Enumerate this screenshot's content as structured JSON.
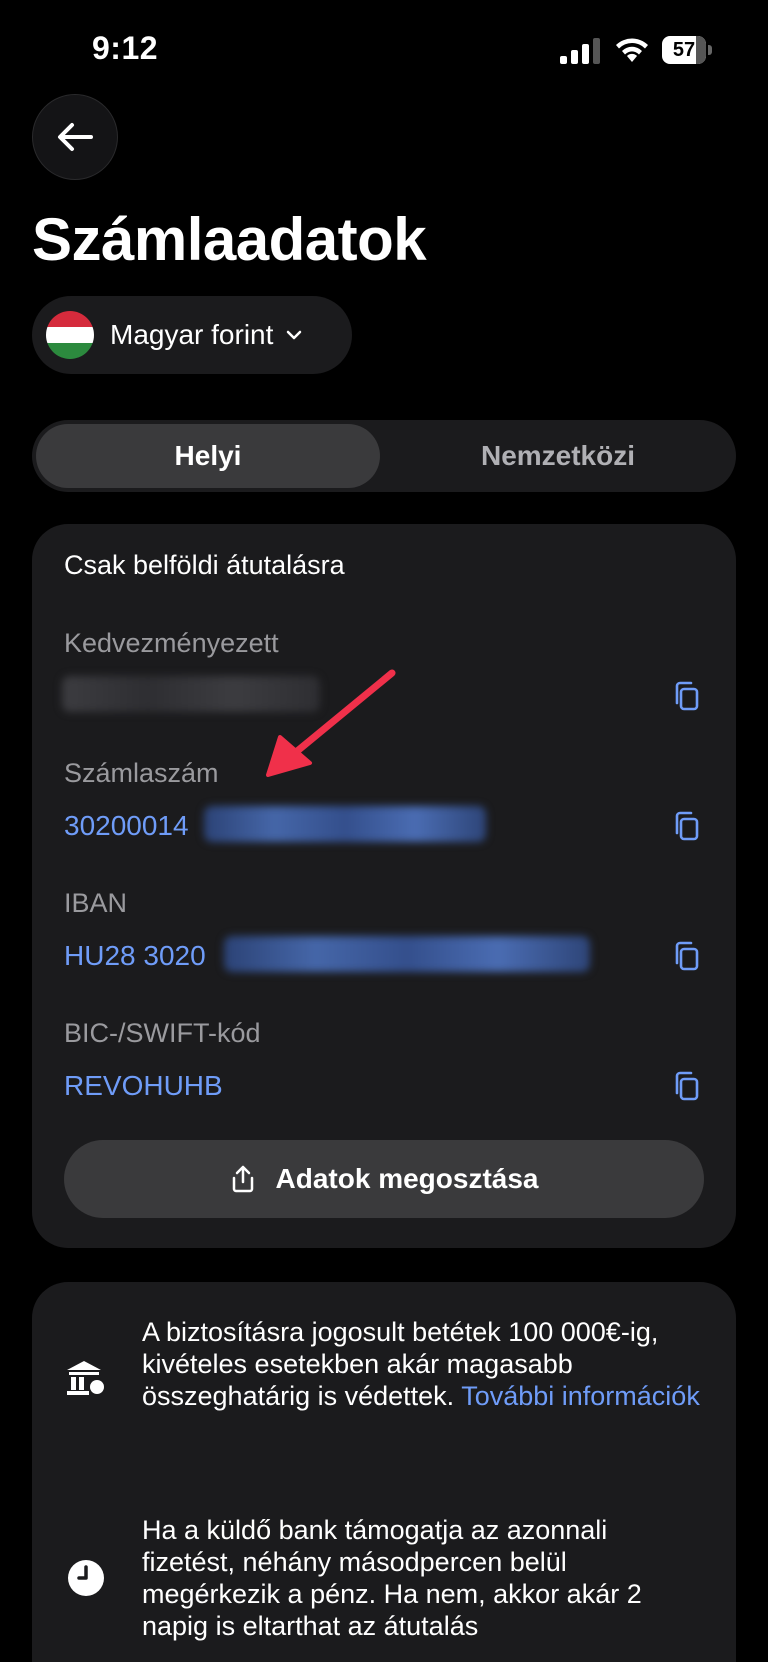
{
  "status_bar": {
    "time": "9:12",
    "battery": "57"
  },
  "header": {
    "title": "Számlaadatok"
  },
  "currency": {
    "label": "Magyar forint"
  },
  "tabs": [
    {
      "label": "Helyi",
      "active": true
    },
    {
      "label": "Nemzetközi",
      "active": false
    }
  ],
  "details": {
    "heading": "Csak belföldi átutalásra",
    "beneficiary_label": "Kedvezményezett",
    "account_label": "Számlaszám",
    "account_value_visible": "30200014",
    "iban_label": "IBAN",
    "iban_value_visible": "HU28 3020",
    "bic_label": "BIC-/SWIFT-kód",
    "bic_value": "REVOHUHB",
    "share_label": "Adatok megosztása"
  },
  "info": {
    "deposit_text": "A biztosításra jogosult betétek 100 000€-ig, kivételes esetekben akár magasabb összeghatárig is védettek.",
    "deposit_link": "További információk",
    "transfer_text": "Ha a küldő bank támogatja az azonnali fizetést, néhány másodpercen belül megérkezik a pénz. Ha nem, akkor akár 2 napig is eltarthat az átutalás"
  },
  "colors": {
    "accent_link": "#6f9cf8",
    "annotation_arrow": "#f0304a",
    "card_bg": "#1b1b1d"
  },
  "icons": [
    "back-arrow-icon",
    "chevron-down-icon",
    "copy-icon",
    "share-icon",
    "bank-shield-icon",
    "clock-icon"
  ]
}
